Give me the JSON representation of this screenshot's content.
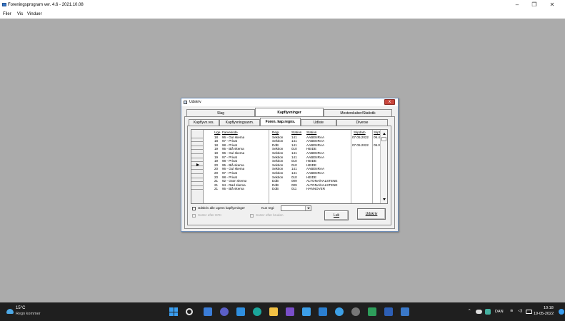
{
  "app": {
    "title": "Foreningsprogram ver. 4.6  -  2021.10.08",
    "menu": [
      "Filer",
      "Vis",
      "Vinduer"
    ],
    "controls": {
      "minimize": "–",
      "restore": "❐",
      "close": "✕"
    }
  },
  "dialog": {
    "title": "Udskriv",
    "close_glyph": "x",
    "main_tabs": [
      "Slag",
      "Kapflyvninger",
      "Mesterskaber/Statistik"
    ],
    "sub_tabs": [
      "Kapflyvn.res.",
      "Kapflyvningsanm.",
      "Foren. kap.regns.",
      "Udlste",
      "Diverse"
    ],
    "grid": {
      "headers": {
        "uge": "Uge",
        "farvekode": "Farvekode",
        "regi": "Regi",
        "station_nr": "Station",
        "station": "Station",
        "slipdato": "Slipdato",
        "sliptid": "Sliptid"
      },
      "rows": [
        {
          "uge": "18",
          "farvekode": "96 - Gul skema",
          "regi": "Sektion",
          "station_nr": "141",
          "station": "AABENRAA",
          "slipdato": "07.05.2022",
          "sliptid": "09.45"
        },
        {
          "uge": "18",
          "farvekode": "97 - Privat",
          "regi": "Sektion",
          "station_nr": "141",
          "station": "AABENRAA",
          "slipdato": "",
          "sliptid": ""
        },
        {
          "uge": "18",
          "farvekode": "98 - Privat",
          "regi": "DdB",
          "station_nr": "141",
          "station": "AABENRAA",
          "slipdato": "07.05.2022",
          "sliptid": "09.00"
        },
        {
          "uge": "19",
          "farvekode": "95 - Blå skema",
          "regi": "Sektion",
          "station_nr": "010",
          "station": "HEIDE",
          "slipdato": "",
          "sliptid": ""
        },
        {
          "uge": "19",
          "farvekode": "96 - Gul skema",
          "regi": "Sektion",
          "station_nr": "141",
          "station": "AABENRAA",
          "slipdato": "",
          "sliptid": ""
        },
        {
          "uge": "19",
          "farvekode": "97 - Privat",
          "regi": "Sektion",
          "station_nr": "141",
          "station": "AABENRAA",
          "slipdato": "",
          "sliptid": ""
        },
        {
          "uge": "19",
          "farvekode": "98 - Privat",
          "regi": "Sektion",
          "station_nr": "010",
          "station": "HEIDE",
          "slipdato": "",
          "sliptid": ""
        },
        {
          "uge": "20",
          "farvekode": "95 - Blå skema",
          "regi": "Sektion",
          "station_nr": "010",
          "station": "HEIDE",
          "slipdato": "",
          "sliptid": ""
        },
        {
          "uge": "20",
          "farvekode": "96 - Gul skema",
          "regi": "Sektion",
          "station_nr": "141",
          "station": "AABENRAA",
          "slipdato": "",
          "sliptid": ""
        },
        {
          "uge": "20",
          "farvekode": "97 - Privat",
          "regi": "Sektion",
          "station_nr": "141",
          "station": "AABENRAA",
          "slipdato": "",
          "sliptid": ""
        },
        {
          "uge": "20",
          "farvekode": "98 - Privat",
          "regi": "Sektion",
          "station_nr": "010",
          "station": "HEIDE",
          "slipdato": "",
          "sliptid": ""
        },
        {
          "uge": "21",
          "farvekode": "92 - Grøn skema",
          "regi": "DdB",
          "station_nr": "009",
          "station": "ALTONA/HALSTENE",
          "slipdato": "",
          "sliptid": ""
        },
        {
          "uge": "21",
          "farvekode": "94 - Rød skema",
          "regi": "DdB",
          "station_nr": "009",
          "station": "ALTONA/HALSTENE",
          "slipdato": "",
          "sliptid": ""
        },
        {
          "uge": "21",
          "farvekode": "95 - Blå skema",
          "regi": "DdB",
          "station_nr": "011",
          "station": "HANNOVER",
          "slipdato": "",
          "sliptid": ""
        }
      ]
    },
    "controls": {
      "print_all_label": "Udskriv alle ugens kapflyvninger",
      "only_regi_label": "Kun regi:",
      "only_regi_value": "",
      "sort_efk_label": "Sorter efter EFK",
      "sort_station_label": "Sorter efter bruden",
      "close_button": "Luk",
      "print_button": "Udskriv"
    }
  },
  "taskbar": {
    "weather_temp": "15°C",
    "weather_desc": "Regn kommer",
    "language": "DAN",
    "time": "10:18",
    "date": "19-05-2022"
  },
  "colors": {
    "desktop": "#ababab",
    "dialog_border": "#6d8db8",
    "close_red": "#c8453b",
    "taskbar": "#1f1f1f",
    "accent": "#3a9ef0"
  }
}
